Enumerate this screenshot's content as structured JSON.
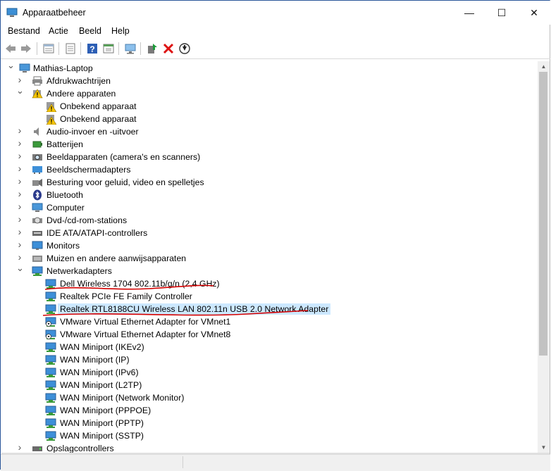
{
  "window": {
    "title": "Apparaatbeheer"
  },
  "caption": {
    "minimize": "—",
    "maximize": "☐",
    "close": "✕"
  },
  "menu": [
    "Bestand",
    "Actie",
    "Beeld",
    "Help"
  ],
  "toolbar": [
    "back-icon",
    "forward-icon",
    "properties-window-icon",
    "properties-icon",
    "help-icon",
    "show-hide-icon",
    "monitor-scan-icon",
    "update-driver-icon",
    "uninstall-icon",
    "disable-icon"
  ],
  "tree": {
    "root": "Mathias-Laptop",
    "categories": [
      {
        "label": "Afdrukwachtrijen",
        "icon": "printer-icon",
        "expanded": false
      },
      {
        "label": "Andere apparaten",
        "icon": "unknown-device-category-icon",
        "expanded": true,
        "children": [
          "Onbekend apparaat",
          "Onbekend apparaat"
        ]
      },
      {
        "label": "Audio-invoer en -uitvoer",
        "icon": "speaker-icon",
        "expanded": false
      },
      {
        "label": "Batterijen",
        "icon": "battery-icon",
        "expanded": false
      },
      {
        "label": "Beeldapparaten (camera's en scanners)",
        "icon": "camera-icon",
        "expanded": false
      },
      {
        "label": "Beeldschermadapters",
        "icon": "display-adapter-icon",
        "expanded": false
      },
      {
        "label": "Besturing voor geluid, video en spelletjes",
        "icon": "sound-icon",
        "expanded": false
      },
      {
        "label": "Bluetooth",
        "icon": "bluetooth-icon",
        "expanded": false
      },
      {
        "label": "Computer",
        "icon": "computer-icon",
        "expanded": false
      },
      {
        "label": "Dvd-/cd-rom-stations",
        "icon": "dvd-icon",
        "expanded": false
      },
      {
        "label": "IDE ATA/ATAPI-controllers",
        "icon": "ide-icon",
        "expanded": false
      },
      {
        "label": "Monitors",
        "icon": "monitor-icon",
        "expanded": false
      },
      {
        "label": "Muizen en andere aanwijsapparaten",
        "icon": "mouse-icon",
        "expanded": false
      },
      {
        "label": "Netwerkadapters",
        "icon": "network-adapter-icon",
        "expanded": true,
        "children": [
          "Dell Wireless 1704 802.11b/g/n (2,4 GHz)",
          "Realtek PCIe FE Family Controller",
          "Realtek RTL8188CU Wireless LAN 802.11n USB 2.0 Network Adapter",
          "VMware Virtual Ethernet Adapter for VMnet1",
          "VMware Virtual Ethernet Adapter for VMnet8",
          "WAN Miniport (IKEv2)",
          "WAN Miniport (IP)",
          "WAN Miniport (IPv6)",
          "WAN Miniport (L2TP)",
          "WAN Miniport (Network Monitor)",
          "WAN Miniport (PPPOE)",
          "WAN Miniport (PPTP)",
          "WAN Miniport (SSTP)"
        ]
      },
      {
        "label": "Opslagcontrollers",
        "icon": "storage-icon",
        "expanded": false
      }
    ],
    "selected": "Realtek RTL8188CU Wireless LAN 802.11n USB 2.0 Network Adapter"
  },
  "annotations": {
    "color": "#d40000"
  }
}
